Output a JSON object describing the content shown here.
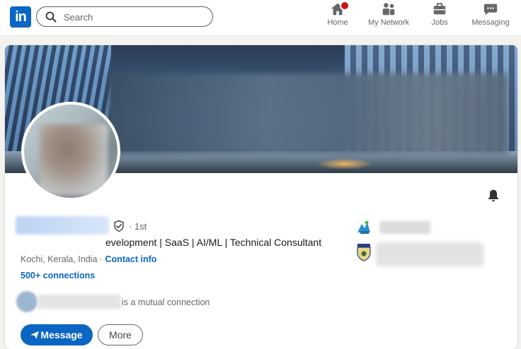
{
  "nav": {
    "logo": "in",
    "search_placeholder": "Search",
    "items": [
      {
        "label": "Home",
        "icon": "home-icon"
      },
      {
        "label": "My Network",
        "icon": "network-icon"
      },
      {
        "label": "Jobs",
        "icon": "briefcase-icon"
      },
      {
        "label": "Messaging",
        "icon": "messaging-icon"
      }
    ]
  },
  "profile": {
    "degree": "· 1st",
    "headline": "evelopment | SaaS | AI/ML | Technical Consultant",
    "location": "Kochi, Kerala, India · ",
    "contact_info": "Contact info",
    "connections": "500+ connections",
    "mutual": "is a mutual connection",
    "message_button": "Message",
    "more_button": "More"
  },
  "colors": {
    "brand": "#0a66c2",
    "notification": "#cc1016"
  }
}
